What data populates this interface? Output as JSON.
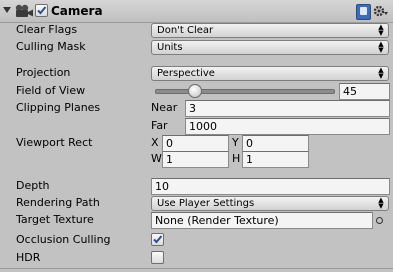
{
  "header": {
    "title": "Camera",
    "enabled": true
  },
  "icons": {
    "foldout": "foldout-arrow-icon",
    "camera": "camera-icon",
    "help": "help-book-icon",
    "settings": "gear-icon"
  },
  "labels": {
    "clear_flags": "Clear Flags",
    "culling_mask": "Culling Mask",
    "projection": "Projection",
    "field_of_view": "Field of View",
    "clipping_planes": "Clipping Planes",
    "viewport_rect": "Viewport Rect",
    "depth": "Depth",
    "rendering_path": "Rendering Path",
    "target_texture": "Target Texture",
    "occlusion_culling": "Occlusion Culling",
    "hdr": "HDR"
  },
  "values": {
    "clear_flags": "Don't Clear",
    "culling_mask": "Units",
    "projection": "Perspective",
    "field_of_view": "45",
    "field_of_view_fraction": 0.2,
    "near_label": "Near",
    "near": "3",
    "far_label": "Far",
    "far": "1000",
    "x_label": "X",
    "x": "0",
    "y_label": "Y",
    "y": "0",
    "w_label": "W",
    "w": "1",
    "h_label": "H",
    "h": "1",
    "depth": "10",
    "rendering_path": "Use Player Settings",
    "target_texture": "None (Render Texture)",
    "occlusion_culling": true,
    "hdr": false
  }
}
